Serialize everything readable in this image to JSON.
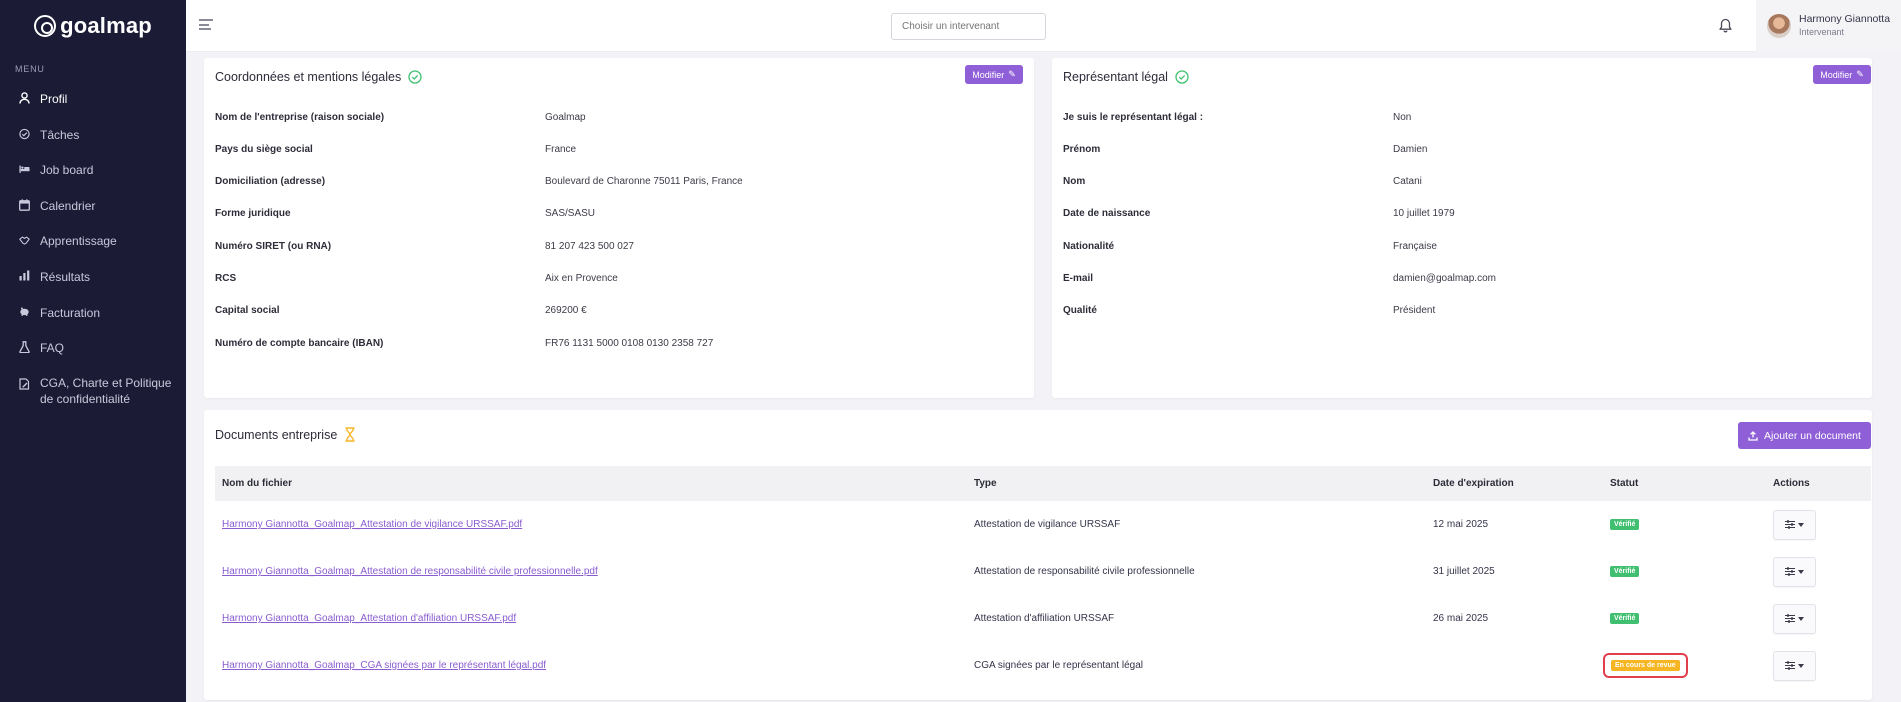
{
  "app": {
    "brand": "goalmap"
  },
  "sidebar": {
    "menu_heading": "MENU",
    "items": [
      {
        "label": "Profil",
        "icon": "user-icon",
        "active": true
      },
      {
        "label": "Tâches",
        "icon": "check-circle-icon"
      },
      {
        "label": "Job board",
        "icon": "bed-icon"
      },
      {
        "label": "Calendrier",
        "icon": "calendar-icon"
      },
      {
        "label": "Apprentissage",
        "icon": "handshake-icon"
      },
      {
        "label": "Résultats",
        "icon": "bar-chart-icon"
      },
      {
        "label": "Facturation",
        "icon": "piggy-bank-icon"
      },
      {
        "label": "FAQ",
        "icon": "flask-icon"
      },
      {
        "label": "CGA, Charte et Politique de confidentialité",
        "icon": "document-edit-icon"
      }
    ]
  },
  "topbar": {
    "search_placeholder": "Choisir un intervenant",
    "user": {
      "name": "Harmony Giannotta",
      "role": "Intervenant"
    }
  },
  "company_card": {
    "title": "Coordonnées et mentions légales",
    "modify_label": "Modifier",
    "fields": [
      {
        "label": "Nom de l'entreprise (raison sociale)",
        "value": "Goalmap"
      },
      {
        "label": "Pays du siège social",
        "value": "France"
      },
      {
        "label": "Domiciliation (adresse)",
        "value": "Boulevard de Charonne 75011 Paris, France"
      },
      {
        "label": "Forme juridique",
        "value": "SAS/SASU"
      },
      {
        "label": "Numéro SIRET (ou RNA)",
        "value": "81 207 423 500 027"
      },
      {
        "label": "RCS",
        "value": "Aix en Provence"
      },
      {
        "label": "Capital social",
        "value": "269200 €"
      },
      {
        "label": "Numéro de compte bancaire (IBAN)",
        "value": "FR76 1131 5000 0108 0130 2358 727"
      }
    ]
  },
  "legal_rep_card": {
    "title": "Représentant légal",
    "modify_label": "Modifier",
    "fields": [
      {
        "label": "Je suis le représentant légal :",
        "value": "Non"
      },
      {
        "label": "Prénom",
        "value": "Damien"
      },
      {
        "label": "Nom",
        "value": "Catani"
      },
      {
        "label": "Date de naissance",
        "value": "10 juillet 1979"
      },
      {
        "label": "Nationalité",
        "value": "Française"
      },
      {
        "label": "E-mail",
        "value": "damien@goalmap.com"
      },
      {
        "label": "Qualité",
        "value": "Président"
      }
    ]
  },
  "documents": {
    "title": "Documents entreprise",
    "add_label": "Ajouter un document",
    "columns": {
      "file": "Nom du fichier",
      "type": "Type",
      "expiry": "Date d'expiration",
      "status": "Statut",
      "actions": "Actions"
    },
    "rows": [
      {
        "file": "Harmony Giannotta_Goalmap_Attestation de vigilance URSSAF.pdf",
        "type": "Attestation de vigilance URSSAF",
        "expiry": "12 mai 2025",
        "status": "Vérifié",
        "status_color": "#3fbf6f"
      },
      {
        "file": "Harmony Giannotta_Goalmap_Attestation de responsabilité civile professionnelle.pdf",
        "type": "Attestation de responsabilité civile professionnelle",
        "expiry": "31 juillet 2025",
        "status": "Vérifié",
        "status_color": "#3fbf6f"
      },
      {
        "file": "Harmony Giannotta_Goalmap_Attestation d'affiliation URSSAF.pdf",
        "type": "Attestation d'affiliation URSSAF",
        "expiry": "26 mai 2025",
        "status": "Vérifié",
        "status_color": "#3fbf6f"
      },
      {
        "file": "Harmony Giannotta_Goalmap_CGA signées par le représentant légal.pdf",
        "type": "CGA signées par le représentant légal",
        "expiry": "",
        "status": "En cours de revue",
        "status_color": "#f6b623"
      }
    ]
  },
  "colors": {
    "sidebar_bg": "#1c1b36",
    "accent_purple": "#8e5fd6",
    "success_green": "#3fbf6f",
    "pending_yellow": "#f6b623",
    "highlight_red": "#e23f4d"
  }
}
